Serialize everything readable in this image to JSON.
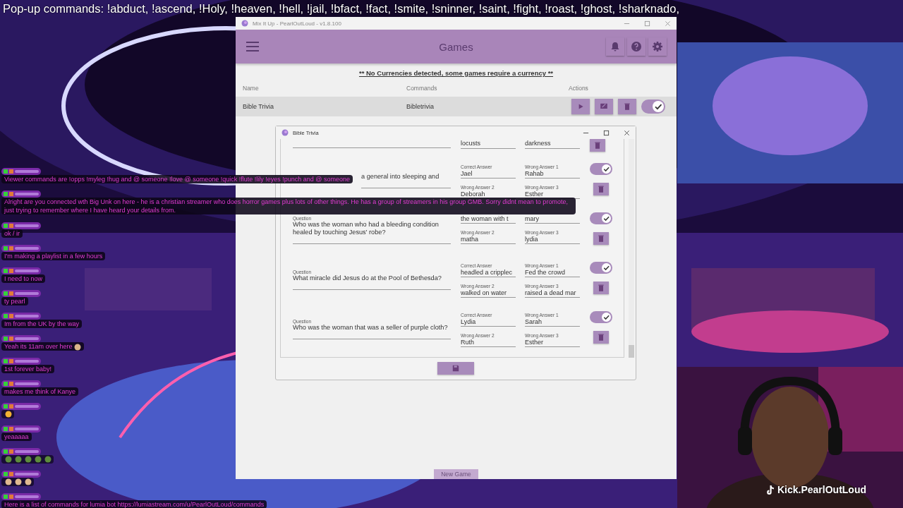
{
  "ticker": "Pop-up commands: !abduct, !ascend, !Holy, !heaven, !hell, !jail, !bfact, !fact, !smite, !sninner, !saint, !fight, !roast, !ghost, !sharknado,",
  "app": {
    "title": "Mix It Up - PearlOutLoud - v1.8.100",
    "header": "Games",
    "notice": "** No Currencies detected, some games require a currency **",
    "columns": [
      "Name",
      "Commands",
      "Actions"
    ],
    "rows": [
      {
        "name": "Bible Trivia",
        "command": "Bibletrivia",
        "enabled": true
      }
    ],
    "new_game": "New Game"
  },
  "dialog": {
    "title": "Bible Trivia",
    "questions": [
      {
        "kind": "partial",
        "answers": [
          {
            "value": "locusts"
          },
          {
            "value": "darkness"
          }
        ]
      },
      {
        "kind": "covered",
        "question": "a general into sleeping and",
        "answers": [
          {
            "label": "Correct Answer",
            "value": "Jael"
          },
          {
            "label": "Wrong Answer 1",
            "value": "Rahab"
          },
          {
            "label": "Wrong Answer 2",
            "value": "Deborah"
          },
          {
            "label": "Wrong Answer 3",
            "value": "Esther"
          }
        ],
        "enabled": true
      },
      {
        "kind": "full",
        "label": "Question",
        "question": "Who was the woman who had a bleeding condition healed by touching Jesus' robe?",
        "answers": [
          {
            "value": "the woman with t"
          },
          {
            "value": "mary"
          },
          {
            "label": "Wrong Answer 2",
            "value": "matha"
          },
          {
            "label": "Wrong Answer 3",
            "value": "lydia"
          }
        ],
        "enabled": true
      },
      {
        "kind": "full",
        "label": "Question",
        "question": "What miracle did Jesus do at the Pool of Bethesda?",
        "answers": [
          {
            "label": "Correct Answer",
            "value": "headled a crippleс"
          },
          {
            "label": "Wrong Answer 1",
            "value": "Fed the crowd"
          },
          {
            "label": "Wrong Answer 2",
            "value": "walked on water"
          },
          {
            "label": "Wrong Answer 3",
            "value": "raised a dead mar"
          }
        ],
        "enabled": true
      },
      {
        "kind": "full",
        "label": "Question",
        "question": "Who was the woman that was a seller of purple cloth?",
        "answers": [
          {
            "label": "Correct Answer",
            "value": "Lydia"
          },
          {
            "label": "Wrong Answer 1",
            "value": "Sarah"
          },
          {
            "label": "Wrong Answer 2",
            "value": "Ruth"
          },
          {
            "label": "Wrong Answer 3",
            "value": "Esther"
          }
        ],
        "enabled": true
      }
    ]
  },
  "chat": [
    {
      "kind": "text",
      "text": "Viewer commands are !opps !myleg !hug and @ someone !love @ someone !quick !flute !lily !eyes !punch and @ someone"
    },
    {
      "kind": "text",
      "text": "Alright are you connected wth Big Unk on here - he is a christian streamer who does horror games plus lots of other things. He has a group of streamers in his group GMB. Sorry didnt mean to promote, just trying to remember where I have heard your details from."
    },
    {
      "kind": "text",
      "text": "ok / ir"
    },
    {
      "kind": "text",
      "text": "I'm making a playlist in a few hours"
    },
    {
      "kind": "text",
      "text": "I need to now"
    },
    {
      "kind": "text",
      "text": "ty pearl"
    },
    {
      "kind": "text",
      "text": "Im from the UK by the way"
    },
    {
      "kind": "text",
      "text": "Yeah its 11am over here",
      "emotes": [
        {
          "color": "#d9b48a"
        }
      ]
    },
    {
      "kind": "text",
      "text": "1st forever baby!"
    },
    {
      "kind": "text",
      "text": "makes me think of Kanye"
    },
    {
      "kind": "emotes",
      "emotes": [
        {
          "color": "#f2b233"
        }
      ]
    },
    {
      "kind": "text",
      "text": "yeaaaaa"
    },
    {
      "kind": "emotes",
      "emotes": [
        {
          "color": "#5d8c3c"
        },
        {
          "color": "#5d8c3c"
        },
        {
          "color": "#5d8c3c"
        },
        {
          "color": "#5d8c3c"
        },
        {
          "color": "#5d8c3c"
        }
      ]
    },
    {
      "kind": "emotes",
      "emotes": [
        {
          "color": "#e0b890"
        },
        {
          "color": "#e0b890"
        },
        {
          "color": "#e0b890"
        }
      ]
    },
    {
      "kind": "link",
      "text": "Here is a list of commands for lumia bot",
      "link": "https://lumiastream.com/u/PearlOutLoud/commands"
    }
  ],
  "handle": "Kick.PearlOutLoud"
}
